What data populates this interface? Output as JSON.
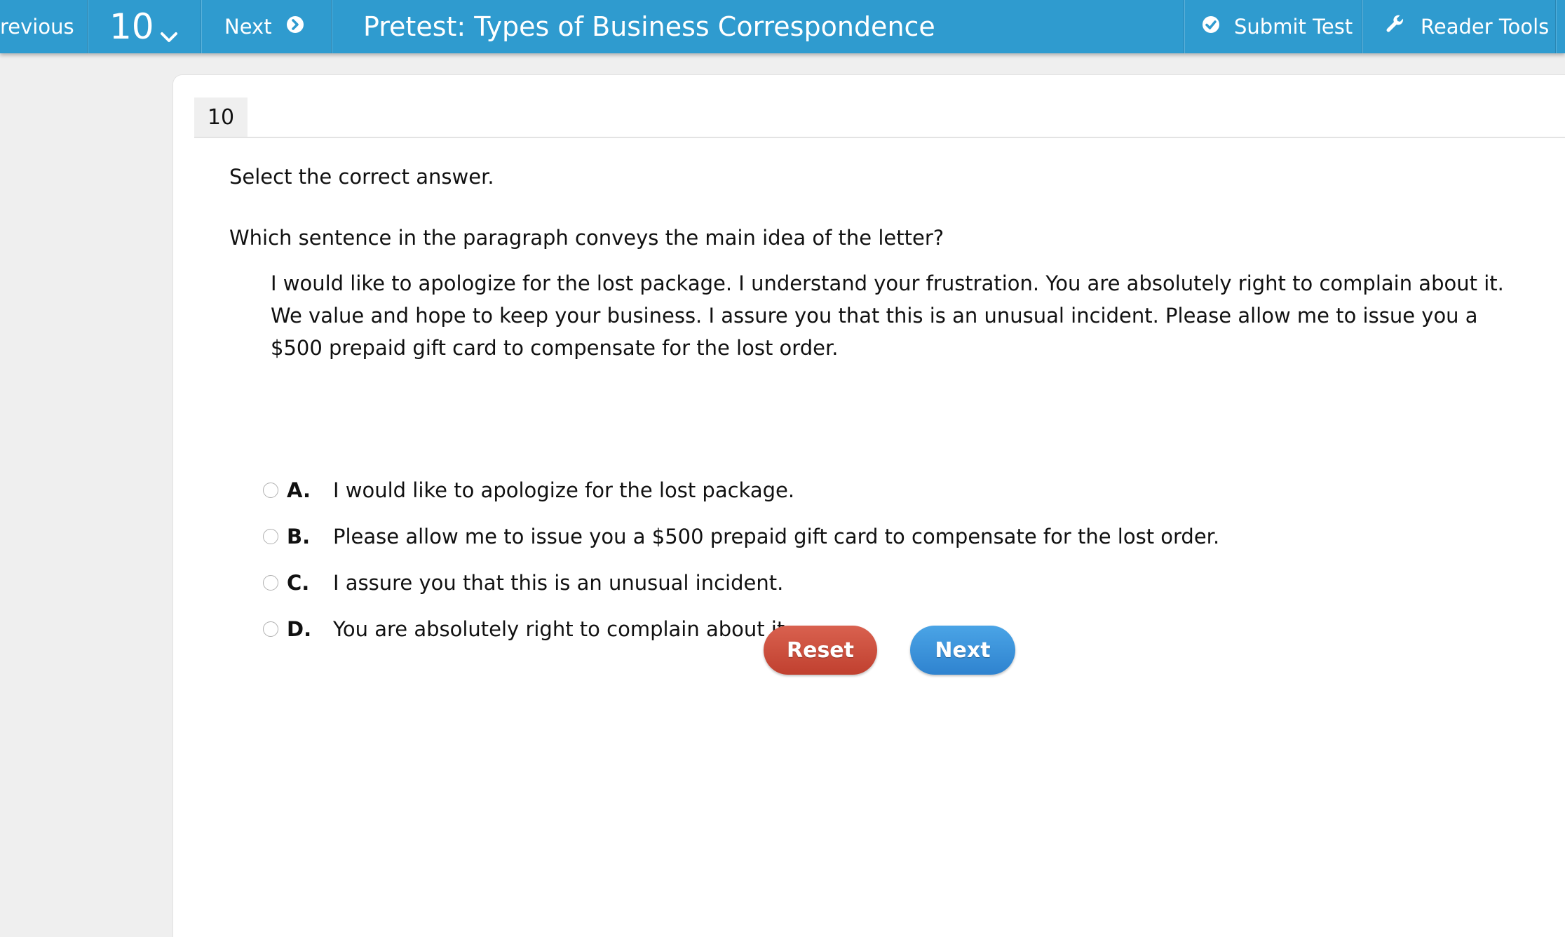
{
  "toolbar": {
    "previous_label": "revious",
    "question_number": "10",
    "next_label": "Next",
    "title": "Pretest: Types of Business Correspondence",
    "submit_label": "Submit Test",
    "reader_tools_label": "Reader Tools",
    "bar_color": "#2f9bcf"
  },
  "question": {
    "tab_number": "10",
    "instruction": "Select the correct answer.",
    "prompt": "Which sentence in the paragraph conveys the main idea of the letter?",
    "passage": "I would like to apologize for the lost package. I understand your frustration. You are absolutely right to complain about it. We value and hope to keep your business. I assure you that this is an unusual incident. Please allow me to issue you a $500 prepaid gift card to compensate for the lost order.",
    "options": [
      {
        "letter": "A.",
        "text": "I would like to apologize for the lost package.",
        "selected": false
      },
      {
        "letter": "B.",
        "text": "Please allow me to issue you a $500 prepaid gift card to compensate for the lost order.",
        "selected": false
      },
      {
        "letter": "C.",
        "text": "I assure you that this is an unusual incident.",
        "selected": false
      },
      {
        "letter": "D.",
        "text": "You are absolutely right to complain about it.",
        "selected": false
      }
    ]
  },
  "actions": {
    "reset_label": "Reset",
    "next_label": "Next",
    "reset_color": "#c9483a",
    "next_color": "#3a91dc"
  },
  "icons": {
    "chevron": "chevron-down-icon",
    "next": "arrow-circle-right-icon",
    "submit": "check-circle-icon",
    "tools": "wrench-icon"
  }
}
